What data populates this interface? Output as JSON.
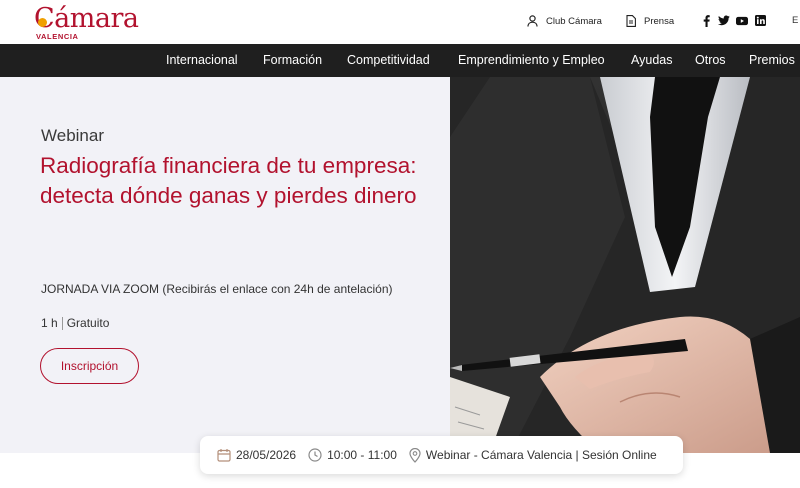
{
  "header": {
    "logo_text": "Cámara",
    "logo_sub": "VALENCIA",
    "club_label": "Club Cámara",
    "prensa_label": "Prensa",
    "lang_label": "E",
    "social": [
      "facebook",
      "twitter",
      "youtube",
      "linkedin"
    ]
  },
  "nav": {
    "items": [
      "Internacional",
      "Formación",
      "Competitividad",
      "Emprendimiento y Empleo",
      "Ayudas",
      "Otros",
      "Premios"
    ]
  },
  "hero": {
    "eyebrow": "Webinar",
    "title": "Radiografía financiera de tu empresa: detecta dónde ganas y pierdes dinero",
    "jornada": "JORNADA VIA ZOOM (Recibirás el enlace con 24h de antelación)",
    "duration": "1 h",
    "price": "Gratuito",
    "cta_label": "Inscripción"
  },
  "info": {
    "date": "28/05/2026",
    "time": "10:00 - 11:00",
    "location": "Webinar - Cámara Valencia | Sesión Online"
  },
  "colors": {
    "brand": "#b2122e",
    "accent_dot": "#f0a000",
    "nav_bg": "#1f1f1f",
    "hero_bg": "#f2f2f7"
  }
}
